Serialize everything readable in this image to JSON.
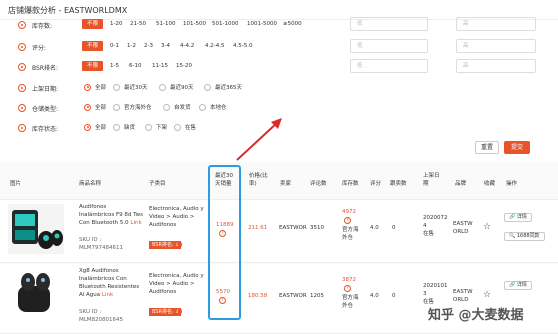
{
  "app": {
    "title": "店铺爆款分析 - EASTWORLDMX"
  },
  "filters": {
    "inventory": {
      "label": "库存数:",
      "options": [
        "不限",
        "1-20",
        "21-50",
        "51-100",
        "101-500",
        "501-1000",
        "1001-5000",
        "≥5000"
      ],
      "active": 0,
      "min_placeholder": "低",
      "max_placeholder": "高"
    },
    "rating": {
      "label": "评分:",
      "options": [
        "不限",
        "0-1",
        "1-2",
        "2-3",
        "3-4",
        "4-4.2",
        "4.2-4.5",
        "4.5-5.0"
      ],
      "active": 0,
      "min_placeholder": "低",
      "max_placeholder": "高"
    },
    "bsr": {
      "label": "BSR排名:",
      "options": [
        "不限",
        "1-5",
        "6-10",
        "11-15",
        "15-20"
      ],
      "active": 0,
      "min_placeholder": "低",
      "max_placeholder": "高"
    },
    "listing_date": {
      "label": "上架日期:",
      "options": [
        "全部",
        "最近30天",
        "最近90天",
        "最近365天"
      ],
      "selected": 0
    },
    "fulfillment": {
      "label": "仓储类型:",
      "options": [
        "全部",
        "官方海外仓",
        "自发货",
        "本地仓"
      ],
      "selected": 0
    },
    "stock_status": {
      "label": "库存状态:",
      "options": [
        "全部",
        "缺货",
        "下架",
        "在售"
      ],
      "selected": 0
    },
    "reset_label": "重置",
    "submit_label": "提交"
  },
  "table": {
    "headers": [
      "图片",
      "商品名称",
      "子类目",
      "最近30\n天销量",
      "价格(比\n率)",
      "卖家",
      "评论数",
      "库存数",
      "评分",
      "跟卖数",
      "上架日\n期",
      "品牌",
      "收藏",
      "操作"
    ],
    "rows": [
      {
        "name": "Audifonos\nInalámbricos F9 8d Tws\nCon Bluetooth 5.0",
        "link": "Link",
        "sku": "SKU ID :\nMLM797484611",
        "category": "Electronica, Audio y\nVideo > Audio >\nAudifonos",
        "rank_badge": "BSR排名: 1",
        "sales": "11889",
        "price": "211.61",
        "seller": "EASTWOR",
        "reviews": "3510",
        "stock": "4972",
        "warehouse": "官方海\n外仓",
        "rating": "4.0",
        "followers": "0",
        "listing_date": "2020072\n4\n在售",
        "brand": "EASTW\nORLD",
        "detail_label": "详情",
        "collect_label": "1688同款"
      },
      {
        "name": "Xg8 Audifonos\nInalámbricos Con\nBluetooth Resistentes\nAl Agua",
        "link": "Link",
        "sku": "SKU ID :\nMLM820801645",
        "category": "Electronica, Audio y\nVideo > Audio >\nAudifonos",
        "rank_badge": "BSR排名: 2",
        "sales": "5570",
        "price": "180.58",
        "seller": "EASTWOR",
        "reviews": "1205",
        "stock": "3872",
        "warehouse": "官方海\n外仓",
        "rating": "4.0",
        "followers": "0",
        "listing_date": "2020101\n3\n在售",
        "brand": "EASTW\nORLD",
        "detail_label": "详情",
        "collect_label": ""
      }
    ]
  },
  "watermark": "知乎 @大麦数据",
  "colors": {
    "accent": "#e8542a",
    "highlight": "#2d9be0"
  }
}
